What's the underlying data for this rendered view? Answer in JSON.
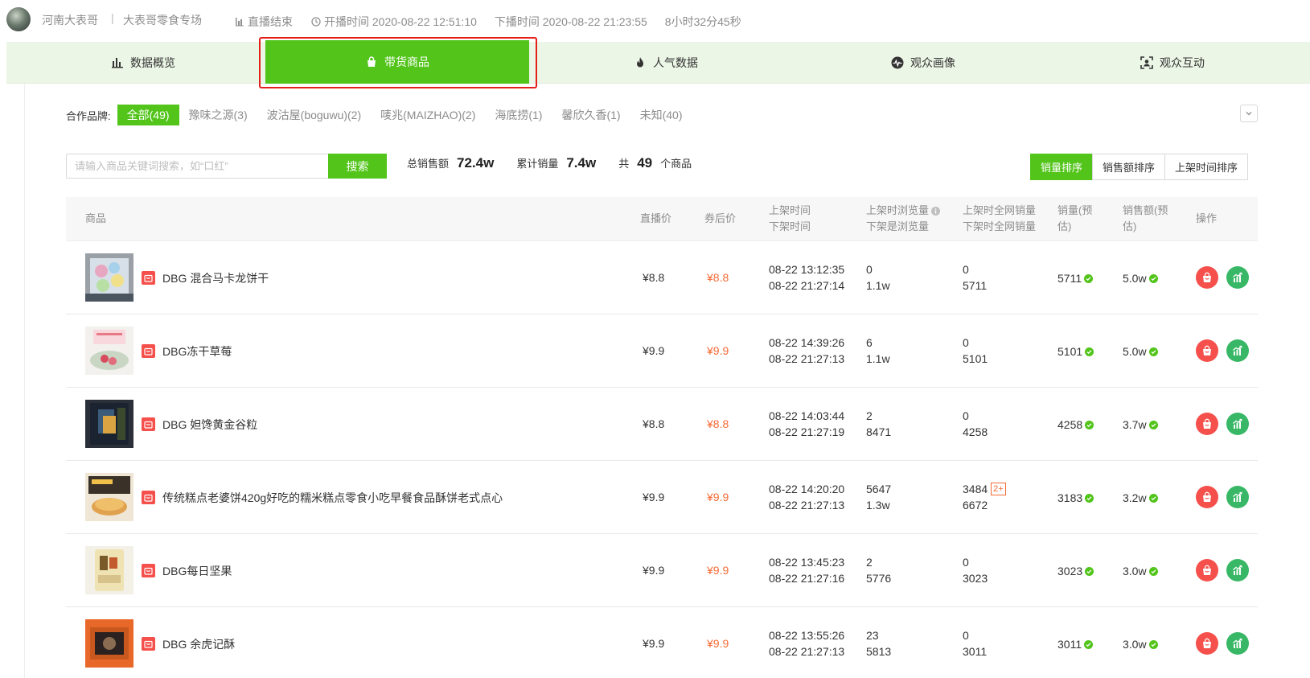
{
  "header": {
    "anchor_name": "河南大表哥",
    "separator": "|",
    "room_name": "大表哥零食专场",
    "status": "直播结束",
    "start_label": "开播时间 2020-08-22 12:51:10",
    "end_label": "下播时间 2020-08-22 21:23:55",
    "duration": "8小时32分45秒"
  },
  "tabs": [
    {
      "label": "数据概览",
      "icon": "bar-chart-icon"
    },
    {
      "label": "带货商品",
      "icon": "shopping-bag-icon"
    },
    {
      "label": "人气数据",
      "icon": "fire-icon"
    },
    {
      "label": "观众画像",
      "icon": "pulse-icon"
    },
    {
      "label": "观众互动",
      "icon": "face-scan-icon"
    }
  ],
  "active_tab": "带货商品",
  "brands": {
    "label": "合作品牌:",
    "items": [
      "全部(49)",
      "豫味之源(3)",
      "波沽屋(boguwu)(2)",
      "唛兆(MAIZHAO)(2)",
      "海底捞(1)",
      "馨欣久香(1)",
      "未知(40)"
    ]
  },
  "search": {
    "placeholder": "请输入商品关键词搜索，如“口红”",
    "button": "搜索"
  },
  "stats": {
    "total_sales_label": "总销售额",
    "total_sales": "72.4w",
    "total_volume_label": "累计销量",
    "total_volume": "7.4w",
    "count_prefix": "共",
    "count": "49",
    "count_suffix": "个商品"
  },
  "sort": [
    "销量排序",
    "销售额排序",
    "上架时间排序"
  ],
  "columns": {
    "product": "商品",
    "live_price": "直播价",
    "coupon_price": "券后价",
    "time_1": "上架时间",
    "time_2": "下架时间",
    "views_1": "上架时浏览量",
    "views_2": "下架是浏览量",
    "net_1": "上架时全网销量",
    "net_2": "下架时全网销量",
    "sales": "销量(预估)",
    "gmv": "销售额(预估)",
    "ops": "操作"
  },
  "rows": [
    {
      "name": "DBG 混合马卡龙饼干",
      "price": "¥8.8",
      "coupon": "¥8.8",
      "on": "08-22 13:12:35",
      "off": "08-22 21:27:14",
      "v_on": "0",
      "v_off": "1.1w",
      "n_on": "0",
      "n_off": "5711",
      "badge": "",
      "sales": "5711",
      "gmv": "5.0w"
    },
    {
      "name": "DBG冻干草莓",
      "price": "¥9.9",
      "coupon": "¥9.9",
      "on": "08-22 14:39:26",
      "off": "08-22 21:27:13",
      "v_on": "6",
      "v_off": "1.1w",
      "n_on": "0",
      "n_off": "5101",
      "badge": "",
      "sales": "5101",
      "gmv": "5.0w"
    },
    {
      "name": "DBG 妲馋黄金谷粒",
      "price": "¥8.8",
      "coupon": "¥8.8",
      "on": "08-22 14:03:44",
      "off": "08-22 21:27:19",
      "v_on": "2",
      "v_off": "8471",
      "n_on": "0",
      "n_off": "4258",
      "badge": "",
      "sales": "4258",
      "gmv": "3.7w"
    },
    {
      "name": "传统糕点老婆饼420g好吃的糯米糕点零食小吃早餐食品酥饼老式点心",
      "price": "¥9.9",
      "coupon": "¥9.9",
      "on": "08-22 14:20:20",
      "off": "08-22 21:27:13",
      "v_on": "5647",
      "v_off": "1.3w",
      "n_on": "3484",
      "n_off": "6672",
      "badge": "2+",
      "sales": "3183",
      "gmv": "3.2w"
    },
    {
      "name": "DBG每日坚果",
      "price": "¥9.9",
      "coupon": "¥9.9",
      "on": "08-22 13:45:23",
      "off": "08-22 21:27:16",
      "v_on": "2",
      "v_off": "5776",
      "n_on": "0",
      "n_off": "3023",
      "badge": "",
      "sales": "3023",
      "gmv": "3.0w"
    },
    {
      "name": "DBG 余虎记酥",
      "price": "¥9.9",
      "coupon": "¥9.9",
      "on": "08-22 13:55:26",
      "off": "08-22 21:27:13",
      "v_on": "23",
      "v_off": "5813",
      "n_on": "0",
      "n_off": "3011",
      "badge": "",
      "sales": "3011",
      "gmv": "3.0w"
    }
  ],
  "colors": {
    "accent": "#52c41a",
    "price_red": "#f56a35",
    "op_red": "#f5504b",
    "op_green": "#38b866",
    "highlight": "#e4201a"
  }
}
